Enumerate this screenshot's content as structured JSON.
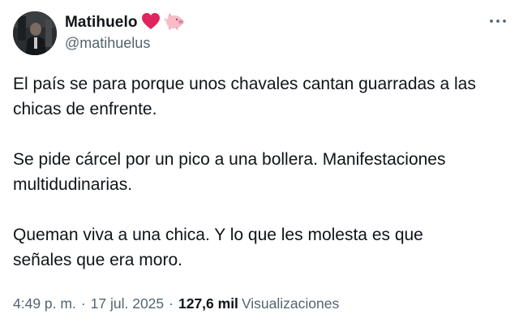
{
  "author": {
    "display_name": "Matihuelo",
    "handle": "@matihuelus",
    "badges": [
      "red-heart-icon",
      "pig-icon"
    ],
    "avatar": "profile-photo"
  },
  "tweet": {
    "paragraphs": [
      [
        "El país se para porque unos chavales cantan guarradas a las",
        "chicas de enfrente."
      ],
      [
        "Se pide cárcel por un pico a una bollera. Manifestaciones",
        "multidudinarias."
      ],
      [
        "Queman viva a una chica. Y lo que les molesta es que",
        "señales que era moro."
      ]
    ]
  },
  "meta": {
    "time": "4:49 p. m.",
    "separator": "·",
    "date": "17 jul. 2025",
    "views_count": "127,6 mil",
    "views_label": "Visualizaciones"
  },
  "colors": {
    "text": "#0f1419",
    "secondary": "#536471",
    "heart": "#e0245e",
    "pig": "#f4abba"
  },
  "icons": {
    "more": "more-options-icon"
  }
}
